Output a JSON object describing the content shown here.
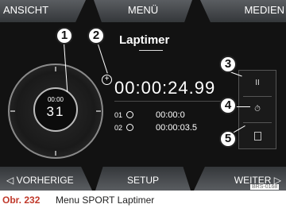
{
  "top_tabs": {
    "left": "ANSICHT",
    "center": "MENÜ",
    "right": "MEDIEN"
  },
  "title": "Laptimer",
  "dial": {
    "time": "00:00",
    "value": "31"
  },
  "current_time": "00:00:24.99",
  "laps": [
    {
      "number": "01",
      "time": "00:00:0"
    },
    {
      "number": "02",
      "time": "00:00:03.5"
    }
  ],
  "side_buttons": {
    "pause": "II",
    "reset": "⏱",
    "delete": ""
  },
  "callouts": [
    "1",
    "2",
    "3",
    "4",
    "5"
  ],
  "bottom_tabs": {
    "left": "◁  VORHERIGE",
    "center": "SETUP",
    "right": "WEITER  ▷"
  },
  "ref_code": "BRS-0168",
  "caption": {
    "label": "Obr. 232",
    "text": "Menu SPORT Laptimer"
  }
}
